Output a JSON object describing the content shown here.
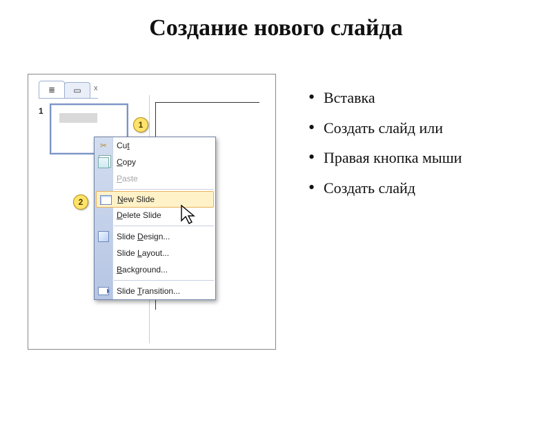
{
  "title": "Создание нового слайда",
  "bullets": [
    "Вставка",
    "Создать слайд или",
    "Правая кнопка мыши",
    "Создать слайд"
  ],
  "tabs": {
    "outline_glyph": "≣",
    "slides_glyph": "▭",
    "close": "x"
  },
  "slide_number": "1",
  "callouts": {
    "one": "1",
    "two": "2"
  },
  "menu": {
    "cut": "Cut",
    "copy": "Copy",
    "paste": "Paste",
    "new_slide": "New Slide",
    "delete_slide": "Delete Slide",
    "slide_design": "Slide Design...",
    "slide_layout": "Slide Layout...",
    "background": "Background...",
    "slide_transition": "Slide Transition...",
    "u": {
      "cut": "t",
      "copy": "C",
      "paste": "P",
      "new": "N",
      "delete": "D",
      "design": "D",
      "layout": "L",
      "background": "B",
      "transition": "T"
    }
  }
}
